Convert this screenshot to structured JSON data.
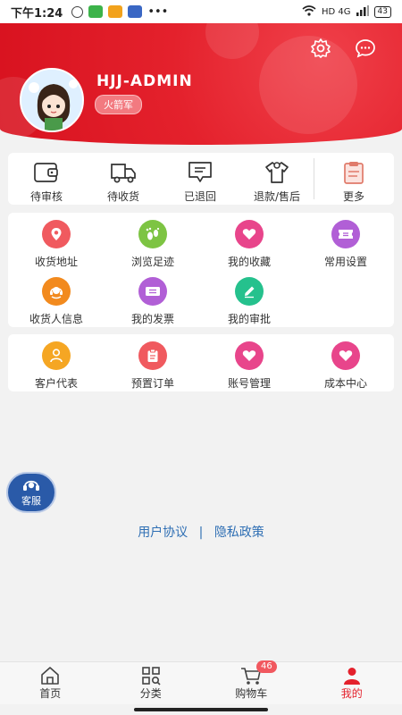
{
  "status_bar": {
    "time": "下午1:24",
    "network": "HD 4G",
    "battery": "43"
  },
  "profile": {
    "username": "HJJ-ADMIN",
    "role": "火箭军"
  },
  "orders": [
    {
      "label": "待审核",
      "icon": "wallet-icon"
    },
    {
      "label": "待收货",
      "icon": "truck-icon"
    },
    {
      "label": "已退回",
      "icon": "message-icon"
    },
    {
      "label": "退款/售后",
      "icon": "shirt-icon"
    },
    {
      "label": "更多",
      "icon": "clipboard-icon"
    }
  ],
  "services": [
    {
      "label": "收货地址",
      "icon": "location-icon",
      "color": "#f05a5f"
    },
    {
      "label": "浏览足迹",
      "icon": "footprint-icon",
      "color": "#7dc443"
    },
    {
      "label": "我的收藏",
      "icon": "heart-icon",
      "color": "#e8458b"
    },
    {
      "label": "常用设置",
      "icon": "ticket-icon",
      "color": "#b15fd6"
    },
    {
      "label": "收货人信息",
      "icon": "headset-icon",
      "color": "#f28a1e"
    },
    {
      "label": "我的发票",
      "icon": "invoice-icon",
      "color": "#b15fd6"
    },
    {
      "label": "我的审批",
      "icon": "pencil-icon",
      "color": "#25c18d"
    }
  ],
  "tools": [
    {
      "label": "客户代表",
      "icon": "person-icon",
      "color": "#f5a623"
    },
    {
      "label": "预置订单",
      "icon": "clipboard-icon",
      "color": "#f05a5f"
    },
    {
      "label": "账号管理",
      "icon": "heart-icon",
      "color": "#e8458b"
    },
    {
      "label": "成本中心",
      "icon": "heart-icon",
      "color": "#e8458b"
    }
  ],
  "customer_service": {
    "label": "客服"
  },
  "footer_links": {
    "agreement": "用户协议",
    "separator": "|",
    "privacy": "隐私政策"
  },
  "tabbar": {
    "tabs": [
      {
        "label": "首页",
        "icon": "home-icon"
      },
      {
        "label": "分类",
        "icon": "category-icon"
      },
      {
        "label": "购物车",
        "icon": "cart-icon"
      },
      {
        "label": "我的",
        "icon": "user-icon"
      }
    ],
    "cart_count": "46",
    "active": "我的"
  },
  "colors": {
    "brand": "#e4212c",
    "link": "#2f6fb4"
  }
}
